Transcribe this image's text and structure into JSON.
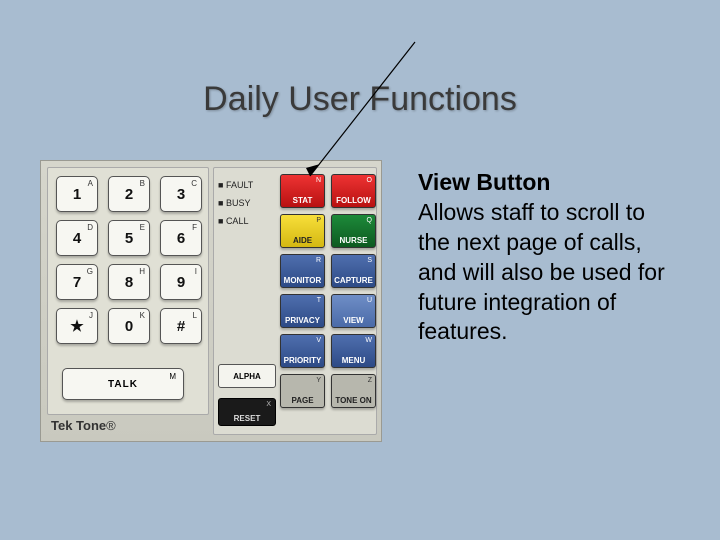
{
  "title": "Daily User Functions",
  "description": {
    "heading": "View Button",
    "body": "Allows staff to scroll to the next page of calls, and will also be used for future integration of features."
  },
  "brand": "Tek Tone",
  "status_leds": [
    "FAULT",
    "BUSY",
    "CALL"
  ],
  "keypad": [
    {
      "main": "1",
      "sup": "A"
    },
    {
      "main": "2",
      "sup": "B"
    },
    {
      "main": "3",
      "sup": "C"
    },
    {
      "main": "4",
      "sup": "D"
    },
    {
      "main": "5",
      "sup": "E"
    },
    {
      "main": "6",
      "sup": "F"
    },
    {
      "main": "7",
      "sup": "G"
    },
    {
      "main": "8",
      "sup": "H"
    },
    {
      "main": "9",
      "sup": "I"
    },
    {
      "main": "★",
      "sup": "J"
    },
    {
      "main": "0",
      "sup": "K"
    },
    {
      "main": "#",
      "sup": "L"
    }
  ],
  "talk": {
    "label": "TALK",
    "sup": "M"
  },
  "alpha": {
    "label": "ALPHA"
  },
  "reset": {
    "label": "RESET",
    "sup": "X"
  },
  "fn_buttons": [
    {
      "label": "STAT",
      "sup": "N",
      "cls": "red"
    },
    {
      "label": "FOLLOW",
      "sup": "O",
      "cls": "red"
    },
    {
      "label": "AIDE",
      "sup": "P",
      "cls": "yellow"
    },
    {
      "label": "NURSE",
      "sup": "Q",
      "cls": "green"
    },
    {
      "label": "MONITOR",
      "sup": "R",
      "cls": "blue"
    },
    {
      "label": "CAPTURE",
      "sup": "S",
      "cls": "blue"
    },
    {
      "label": "PRIVACY",
      "sup": "T",
      "cls": "blue"
    },
    {
      "label": "VIEW",
      "sup": "U",
      "cls": "bluelt"
    },
    {
      "label": "PRIORITY",
      "sup": "V",
      "cls": "blue"
    },
    {
      "label": "MENU",
      "sup": "W",
      "cls": "blue"
    },
    {
      "label": "PAGE",
      "sup": "Y",
      "cls": "grey"
    },
    {
      "label": "TONE ON",
      "sup": "Z",
      "cls": "grey"
    }
  ]
}
